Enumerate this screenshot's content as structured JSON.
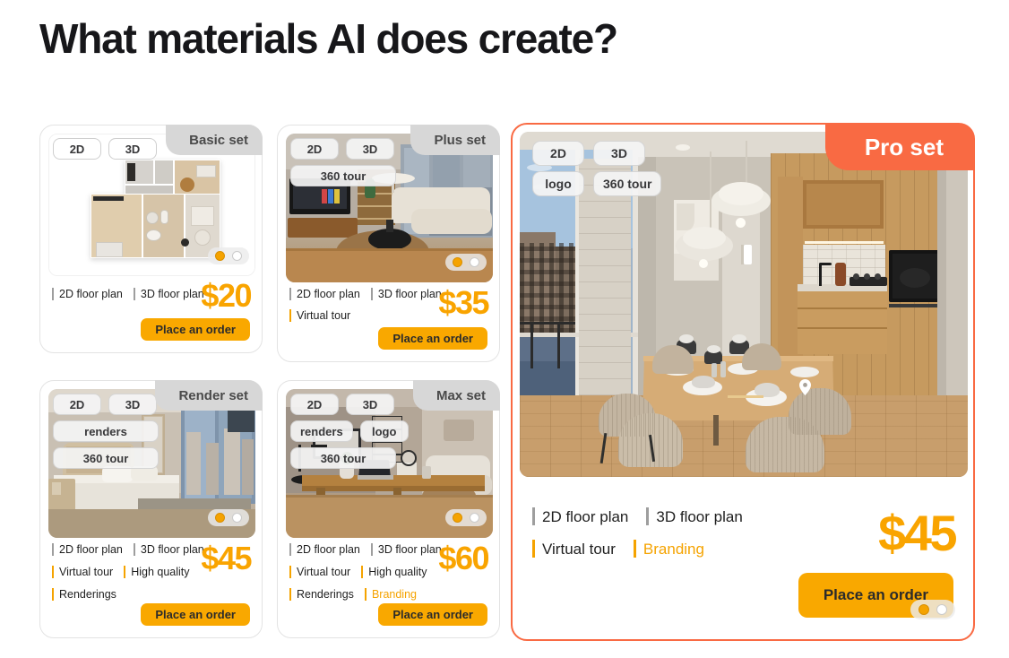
{
  "heading": "What materials AI does create?",
  "accent": {
    "orange": "#F9A400",
    "coral": "#F96A43",
    "gray_tab": "#D7D7D7",
    "text_dark": "#1A1A1A"
  },
  "cards": [
    {
      "id": "basic",
      "title": "Basic set",
      "highlight": false,
      "chips": [
        [
          "2D",
          "3D"
        ]
      ],
      "chip_style": "plain",
      "dots": [
        true,
        false
      ],
      "features": [
        {
          "label": "2D floor plan",
          "tone": "gray"
        },
        {
          "label": "3D floor plan",
          "tone": "gray"
        }
      ],
      "price": "$20",
      "order_label": "Place an order",
      "image_alt": "2D floor plan render"
    },
    {
      "id": "plus",
      "title": "Plus set",
      "highlight": false,
      "chips": [
        [
          "2D",
          "3D"
        ],
        [
          "360 tour"
        ]
      ],
      "chip_style": "glass",
      "dots": [
        true,
        false
      ],
      "features": [
        {
          "label": "2D floor plan",
          "tone": "gray"
        },
        {
          "label": "3D floor plan",
          "tone": "gray"
        },
        {
          "label": "Virtual tour",
          "tone": "orange"
        }
      ],
      "price": "$35",
      "order_label": "Place an order",
      "image_alt": "Living room interior render"
    },
    {
      "id": "render",
      "title": "Render set",
      "highlight": false,
      "chips": [
        [
          "2D",
          "3D"
        ],
        [
          "renders"
        ],
        [
          "360 tour"
        ]
      ],
      "chip_style": "glass",
      "dots": [
        true,
        false
      ],
      "features": [
        {
          "label": "2D floor plan",
          "tone": "gray"
        },
        {
          "label": "3D floor plan",
          "tone": "gray"
        },
        {
          "label": "Virtual tour",
          "tone": "orange"
        },
        {
          "label": "High quality",
          "tone": "orange"
        },
        {
          "label": "Renderings",
          "tone": "orange"
        }
      ],
      "price": "$45",
      "order_label": "Place an order",
      "image_alt": "Bedroom interior render"
    },
    {
      "id": "max",
      "title": "Max set",
      "highlight": false,
      "chips": [
        [
          "2D",
          "3D"
        ],
        [
          "renders",
          "logo"
        ],
        [
          "360 tour"
        ]
      ],
      "chip_style": "glass",
      "dots": [
        true,
        false
      ],
      "features": [
        {
          "label": "2D floor plan",
          "tone": "gray"
        },
        {
          "label": "3D floor plan",
          "tone": "gray"
        },
        {
          "label": "Virtual tour",
          "tone": "orange"
        },
        {
          "label": "High quality",
          "tone": "orange"
        },
        {
          "label": "Renderings",
          "tone": "orange"
        },
        {
          "label": "Branding",
          "tone": "brand"
        }
      ],
      "price": "$60",
      "order_label": "Place an order",
      "image_alt": "Home office interior render"
    },
    {
      "id": "pro",
      "title": "Pro set",
      "highlight": true,
      "chips": [
        [
          "2D",
          "3D"
        ],
        [
          "logo",
          "360 tour"
        ]
      ],
      "chip_style": "glass",
      "dots": [
        true,
        false
      ],
      "features": [
        {
          "label": "2D floor plan",
          "tone": "gray"
        },
        {
          "label": "3D floor plan",
          "tone": "gray"
        },
        {
          "label": "Virtual tour",
          "tone": "orange"
        },
        {
          "label": "Branding",
          "tone": "brand"
        }
      ],
      "price": "$45",
      "order_label": "Place an order",
      "image_alt": "Kitchen and dining room interior render"
    }
  ]
}
